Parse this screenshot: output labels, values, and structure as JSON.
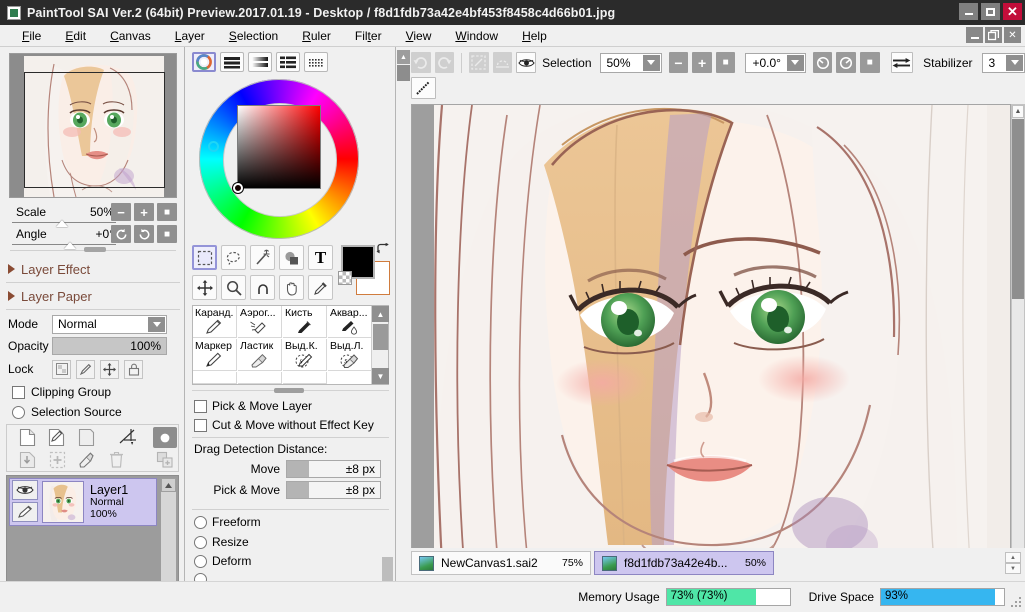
{
  "window": {
    "title": "PaintTool SAI Ver.2 (64bit) Preview.2017.01.19 - Desktop / f8d1fdb73a42e4bf453f8458c4d66b01.jpg",
    "app_icon": "sai-app-icon",
    "minimize": "—",
    "maximize": "▢",
    "close": "✕"
  },
  "menubar": {
    "items": [
      {
        "label": "File",
        "accel": "F"
      },
      {
        "label": "Edit",
        "accel": "E"
      },
      {
        "label": "Canvas",
        "accel": "C"
      },
      {
        "label": "Layer",
        "accel": "L"
      },
      {
        "label": "Selection",
        "accel": "S"
      },
      {
        "label": "Ruler",
        "accel": "R"
      },
      {
        "label": "Filter",
        "accel": "t"
      },
      {
        "label": "View",
        "accel": "V"
      },
      {
        "label": "Window",
        "accel": "W"
      },
      {
        "label": "Help",
        "accel": "H"
      }
    ],
    "doc_minimize": "—",
    "doc_restore": "❐",
    "doc_close": "✕"
  },
  "navigator": {
    "scale": {
      "label": "Scale",
      "value": "50%"
    },
    "angle": {
      "label": "Angle",
      "value": "+0°"
    },
    "scale_buttons": [
      "minus",
      "plus",
      "reset"
    ],
    "angle_buttons": [
      "rotate-ccw",
      "rotate-cw",
      "reset"
    ]
  },
  "layer_sections": [
    {
      "label": "Layer Effect"
    },
    {
      "label": "Layer Paper"
    }
  ],
  "layer_props": {
    "mode_label": "Mode",
    "mode_value": "Normal",
    "opacity_label": "Opacity",
    "opacity_value": "100%",
    "lock_label": "Lock",
    "lock_icons": [
      "lock-pixels-icon",
      "lock-paint-icon",
      "lock-move-icon",
      "lock-all-icon"
    ],
    "clipping_group": "Clipping Group",
    "selection_source": "Selection Source"
  },
  "layer_toolbar": {
    "row1": [
      "new-layer-icon",
      "new-linework-layer-icon",
      "new-folder-icon",
      "ruler-icon",
      "layer-mask-icon"
    ],
    "row2": [
      "merge-down-icon",
      "add-to-selection-icon",
      "clear-layer-icon",
      "delete-layer-icon",
      "duplicate-layer-icon"
    ]
  },
  "layers": [
    {
      "name": "Layer1",
      "mode": "Normal",
      "opacity": "100%",
      "visible_icon": "eye-icon",
      "edit_icon": "pencil-icon",
      "selected": true
    }
  ],
  "color_panel": {
    "mode_buttons": [
      "color-wheel-icon",
      "rgb-sliders-icon",
      "hsv-gradient-icon",
      "color-swatches-icon",
      "color-mixer-icon"
    ],
    "selected_mode": 0,
    "foreground_color": "#000000",
    "background_color": "#ffffff",
    "swap_icon": "swap-colors-icon",
    "transparent_icon": "transparent-color-icon",
    "hue_degrees": 0,
    "square_color": "#ff0000"
  },
  "tools": {
    "row1": [
      {
        "name": "rect-selection-tool",
        "glyph": "▢",
        "selected": true
      },
      {
        "name": "lasso-selection-tool",
        "glyph": "lasso"
      },
      {
        "name": "magic-wand-tool",
        "glyph": "wand"
      },
      {
        "name": "move-selection-tool",
        "glyph": "shapes"
      },
      {
        "name": "text-tool",
        "glyph": "T"
      }
    ],
    "row2": [
      {
        "name": "move-tool",
        "glyph": "move"
      },
      {
        "name": "zoom-tool",
        "glyph": "magnifier"
      },
      {
        "name": "rotate-tool",
        "glyph": "rotate"
      },
      {
        "name": "hand-tool",
        "glyph": "hand"
      },
      {
        "name": "eyedropper-tool",
        "glyph": "dropper"
      }
    ]
  },
  "brushes": [
    {
      "label": "Каранд.",
      "icon": "pencil-icon"
    },
    {
      "label": "Аэрог...",
      "icon": "airbrush-icon"
    },
    {
      "label": "Кисть",
      "icon": "brush-icon"
    },
    {
      "label": "Аквар...",
      "icon": "watercolor-icon"
    },
    {
      "label": "Маркер",
      "icon": "marker-icon"
    },
    {
      "label": "Ластик",
      "icon": "eraser-icon"
    },
    {
      "label": "Выд.К.",
      "icon": "select-brush-icon"
    },
    {
      "label": "Выд.Л.",
      "icon": "select-eraser-icon"
    }
  ],
  "tool_options": {
    "pick_and_move_layer": "Pick & Move Layer",
    "cut_and_move": "Cut & Move without Effect Key",
    "drag_detection_title": "Drag Detection Distance:",
    "move_label": "Move",
    "move_value": "±8 px",
    "pick_move_label": "Pick & Move",
    "pick_move_value": "±8 px",
    "modes": [
      "Freeform",
      "Resize",
      "Deform"
    ]
  },
  "canvas_toolbar": {
    "undo_icon": "undo-icon",
    "redo_icon": "redo-icon",
    "sel_all_icon": "select-all-icon",
    "sel_clear_icon": "deselect-icon",
    "selection_eye_icon": "eye-icon",
    "selection_label": "Selection",
    "zoom_value": "50%",
    "zoom_minus": "−",
    "zoom_plus": "+",
    "zoom_reset": "■",
    "angle_value": "+0.0°",
    "rotate_ccw": "↺",
    "rotate_cw": "↻",
    "angle_reset": "■",
    "flip_icon": "flip-horizontal-icon",
    "stabilizer_label": "Stabilizer",
    "stabilizer_value": "3",
    "line_tool_icon": "line-icon"
  },
  "doc_tabs": [
    {
      "name": "NewCanvas1.sai2",
      "zoom": "75%",
      "active": false
    },
    {
      "name": "f8d1fdb73a42e4b...",
      "zoom": "50%",
      "active": true
    }
  ],
  "statusbar": {
    "memory_label": "Memory Usage",
    "memory_value": "73% (73%)",
    "memory_percent": 73,
    "memory_color": "#4fe6a7",
    "drive_label": "Drive Space",
    "drive_value": "93%",
    "drive_percent": 93,
    "drive_color": "#36b6f0"
  }
}
